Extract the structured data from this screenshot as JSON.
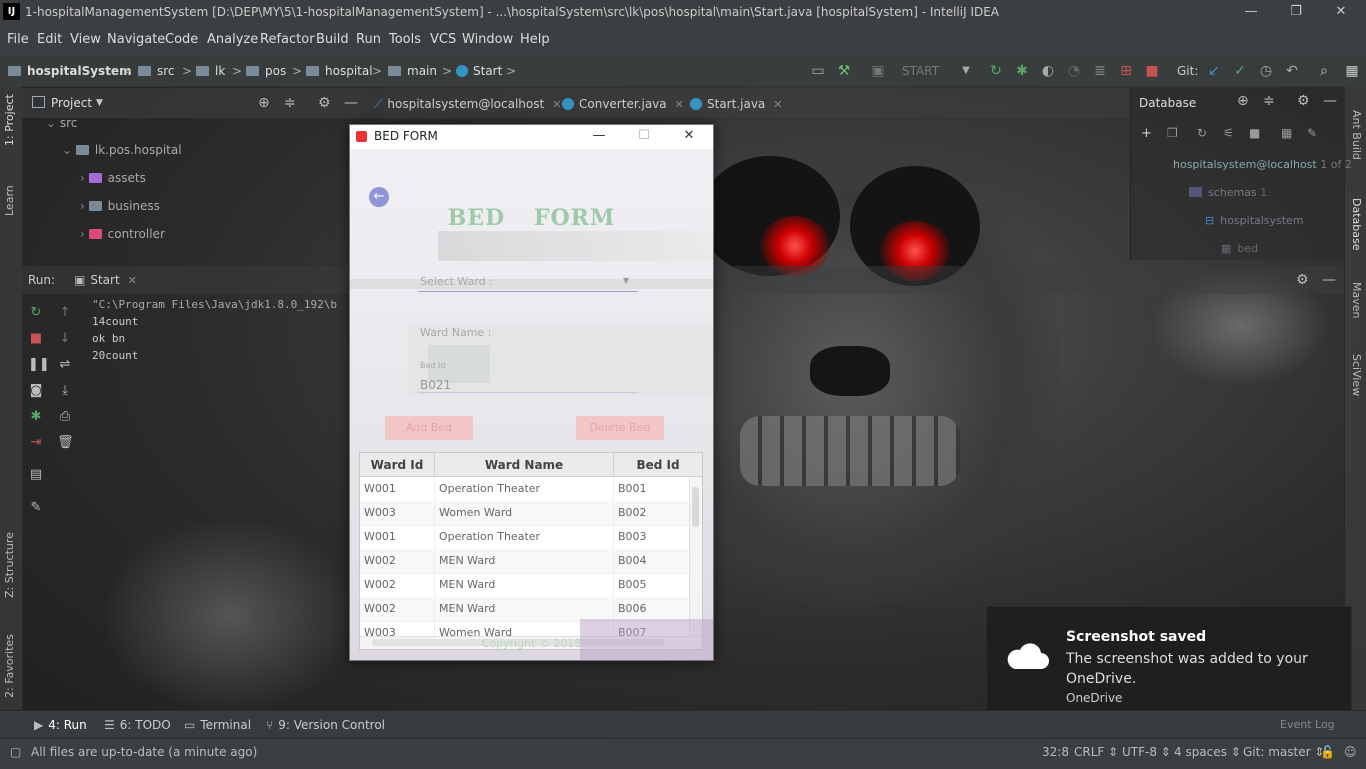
{
  "window": {
    "title": "1-hospitalManagementSystem [D:\\DEP\\MY\\5\\1-hospitalManagementSystem] - ...\\hospitalSystem\\src\\lk\\pos\\hospital\\main\\Start.java [hospitalSystem] - IntelliJ IDEA",
    "logo": "IJ",
    "minimize": "—",
    "restore": "❐",
    "close": "✕"
  },
  "menu": [
    "File",
    "Edit",
    "View",
    "Navigate",
    "Code",
    "Analyze",
    "Refactor",
    "Build",
    "Run",
    "Tools",
    "VCS",
    "Window",
    "Help"
  ],
  "breadcrumb": [
    "hospitalSystem",
    "src",
    "lk",
    "pos",
    "hospital",
    "main",
    "Start"
  ],
  "run_config": "START",
  "git_label": "Git:",
  "project_panel": {
    "title": "Project",
    "tree": [
      "src",
      "lk.pos.hospital",
      "assets",
      "business",
      "controller"
    ]
  },
  "editor_tabs": [
    "hospitalsystem@localhost",
    "Converter.java",
    "Start.java"
  ],
  "database_panel": {
    "title": "Database",
    "tree": [
      "hospitalsystem@localhost",
      "1 of 2",
      "schemas",
      "1",
      "hospitalsystem",
      "bed"
    ]
  },
  "left_tool_tabs": [
    "1: Project",
    "Learn",
    "Z: Structure",
    "2: Favorites"
  ],
  "right_tool_tabs": [
    "Ant Build",
    "Database",
    "Maven",
    "SciView"
  ],
  "run_panel": {
    "label": "Run:",
    "config": "Start",
    "console": [
      "\"C:\\Program Files\\Java\\jdk1.8.0_192\\b",
      "14count",
      "ok bn",
      "20count"
    ]
  },
  "bottom_tabs": [
    "4: Run",
    "6: TODO",
    "Terminal",
    "9: Version Control"
  ],
  "status": {
    "message": "All files are up-to-date (a minute ago)",
    "position": "32:8",
    "line_sep": "CRLF",
    "encoding": "UTF-8",
    "indent": "4 spaces",
    "git": "Git: master",
    "event_log": "Event Log"
  },
  "bed_form": {
    "window_title": "BED FORM",
    "minimize": "—",
    "maximize": "☐",
    "close": "✕",
    "back": "←",
    "heading": "BED FORM",
    "select_ward_placeholder": "Select  Ward :",
    "ward_name_label": "Ward Name :",
    "bed_id_label": "Bed Id",
    "bed_id_value": "B021",
    "add_button": "Add Bed",
    "delete_button": "Delete Bed",
    "table": {
      "headers": [
        "Ward Id",
        "Ward Name",
        "Bed Id"
      ],
      "rows": [
        [
          "W001",
          "Operation Theater",
          "B001"
        ],
        [
          "W003",
          "Women Ward",
          "B002"
        ],
        [
          "W001",
          "Operation Theater",
          "B003"
        ],
        [
          "W002",
          "MEN Ward",
          "B004"
        ],
        [
          "W002",
          "MEN Ward",
          "B005"
        ],
        [
          "W002",
          "MEN Ward",
          "B006"
        ],
        [
          "W003",
          "Women Ward",
          "B007"
        ]
      ]
    },
    "copyright": "Copyright © 2018"
  },
  "toast": {
    "title": "Screenshot saved",
    "message": "The screenshot was added to your OneDrive.",
    "source": "OneDrive"
  }
}
